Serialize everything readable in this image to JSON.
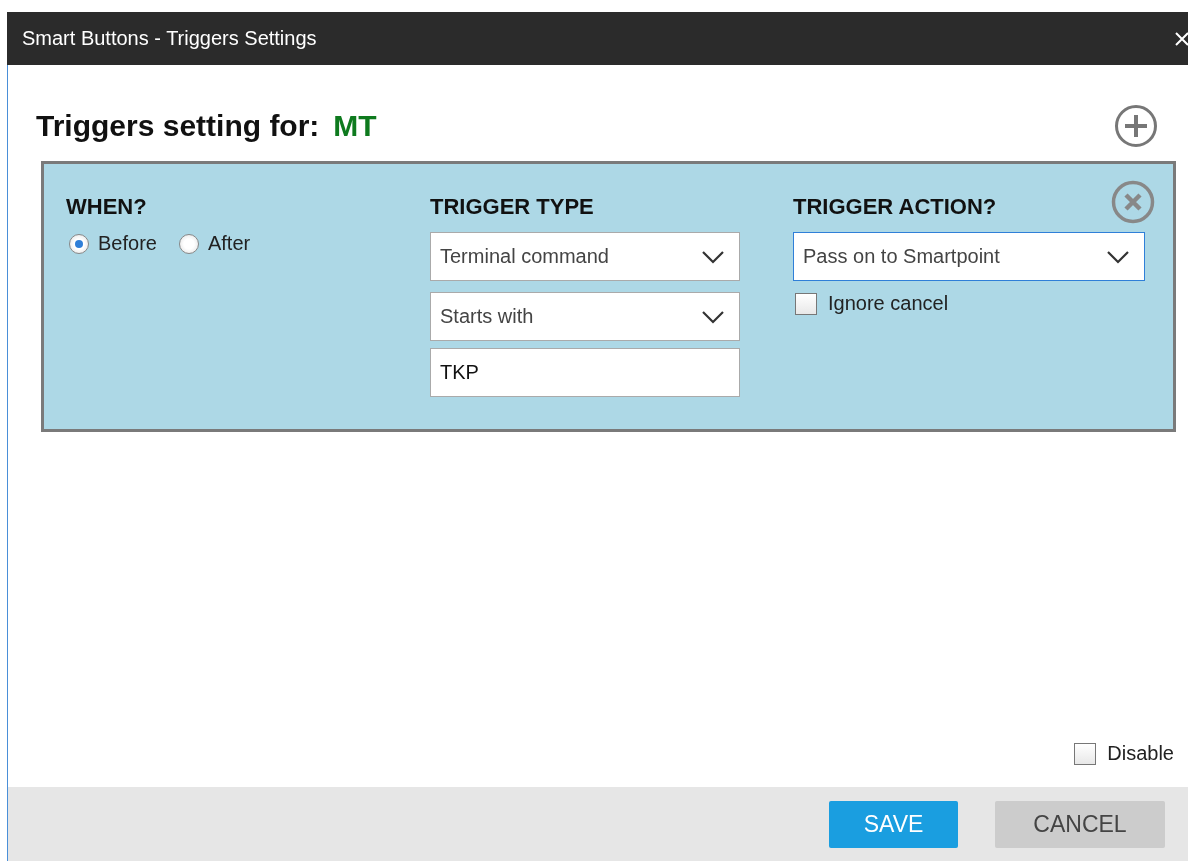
{
  "window": {
    "title": "Smart Buttons - Triggers Settings"
  },
  "heading": {
    "label": "Triggers setting for:",
    "value": "MT"
  },
  "trigger": {
    "when": {
      "label": "WHEN?",
      "options": [
        {
          "label": "Before",
          "selected": true
        },
        {
          "label": "After",
          "selected": false
        }
      ]
    },
    "type": {
      "label": "TRIGGER TYPE",
      "dropdowns": [
        "Terminal command",
        "Starts with"
      ],
      "value": "TKP"
    },
    "action": {
      "label": "TRIGGER ACTION?",
      "dropdown": {
        "value": "Pass on to Smartpoint",
        "focused": true
      },
      "ignore_cancel": {
        "label": "Ignore cancel",
        "checked": false
      }
    }
  },
  "disable": {
    "label": "Disable",
    "checked": false
  },
  "buttons": [
    {
      "label": "SAVE",
      "kind": "primary"
    },
    {
      "label": "CANCEL",
      "kind": "secondary"
    }
  ]
}
